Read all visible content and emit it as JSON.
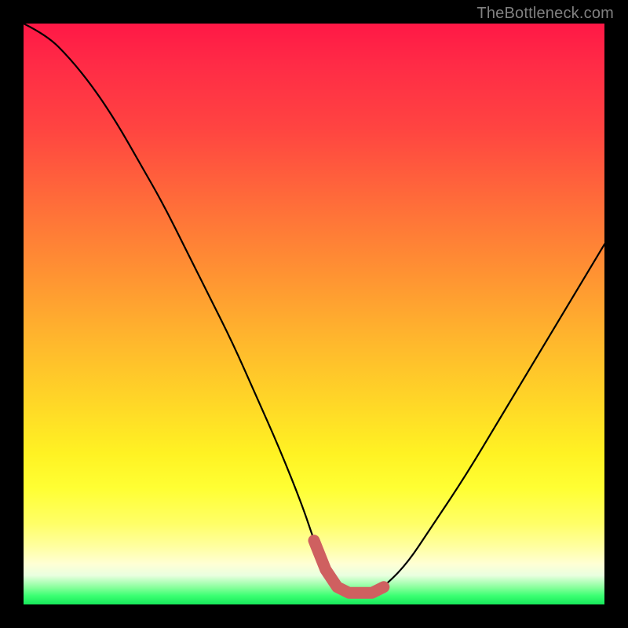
{
  "watermark": "TheBottleneck.com",
  "colors": {
    "background_frame": "#000000",
    "curve_stroke": "#000000",
    "valley_stroke": "#cf6060"
  },
  "chart_data": {
    "type": "line",
    "title": "",
    "xlabel": "",
    "ylabel": "",
    "xlim": [
      0,
      100
    ],
    "ylim": [
      0,
      100
    ],
    "series": [
      {
        "name": "bottleneck-curve",
        "x": [
          0,
          4,
          8,
          12,
          16,
          20,
          24,
          28,
          32,
          36,
          40,
          44,
          48,
          50,
          52,
          54,
          56,
          58,
          60,
          62,
          66,
          70,
          76,
          82,
          88,
          94,
          100
        ],
        "values": [
          100,
          98,
          94,
          89,
          83,
          76,
          69,
          61,
          53,
          45,
          36,
          27,
          17,
          11,
          6,
          3,
          2,
          2,
          2,
          3,
          7,
          13,
          22,
          32,
          42,
          52,
          62
        ]
      }
    ],
    "annotations": [
      {
        "name": "optimal-range",
        "kind": "floor-highlight",
        "x_start": 50,
        "x_end": 62,
        "y": 2
      }
    ],
    "background_gradient": [
      {
        "pos": 0,
        "color": "#ff1846"
      },
      {
        "pos": 50,
        "color": "#ffc028"
      },
      {
        "pos": 80,
        "color": "#ffff33"
      },
      {
        "pos": 100,
        "color": "#17e85a"
      }
    ]
  }
}
